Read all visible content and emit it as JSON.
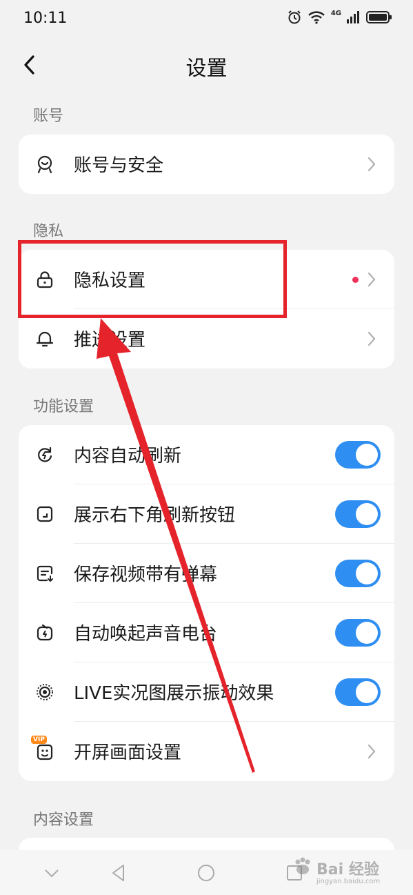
{
  "status_bar": {
    "time": "10:11",
    "network": "4G",
    "icons": [
      "alarm-icon",
      "wifi-icon",
      "signal-icon",
      "battery-icon"
    ]
  },
  "header": {
    "title": "设置",
    "back_icon": "chevron-left-icon"
  },
  "sections": {
    "account": {
      "label": "账号",
      "items": [
        {
          "label": "账号与安全",
          "icon": "account-security-icon"
        }
      ]
    },
    "privacy": {
      "label": "隐私",
      "items": [
        {
          "label": "隐私设置",
          "icon": "lock-icon",
          "badge": "red-dot"
        },
        {
          "label": "推送设置",
          "icon": "bell-icon"
        }
      ]
    },
    "features": {
      "label": "功能设置",
      "items": [
        {
          "label": "内容自动刷新",
          "icon": "refresh-icon",
          "toggle": true
        },
        {
          "label": "展示右下角刷新按钮",
          "icon": "corner-icon",
          "toggle": true
        },
        {
          "label": "保存视频带有弹幕",
          "icon": "danmaku-icon",
          "toggle": true
        },
        {
          "label": "自动唤起声音电台",
          "icon": "radio-icon",
          "toggle": true
        },
        {
          "label": "LIVE实况图展示振动效果",
          "icon": "live-photo-icon",
          "toggle": true
        },
        {
          "label": "开屏画面设置",
          "icon": "splash-vip-icon",
          "vip_badge": "VIP"
        }
      ]
    },
    "content": {
      "label": "内容设置"
    }
  },
  "annotation": {
    "color": "#e5232b"
  },
  "watermark": {
    "main": "Bai 经验",
    "sub": "jingyan.baidu.com"
  },
  "colors": {
    "accent": "#2f8ef2",
    "background": "#f2f2f2",
    "dot": "#f0315a"
  }
}
